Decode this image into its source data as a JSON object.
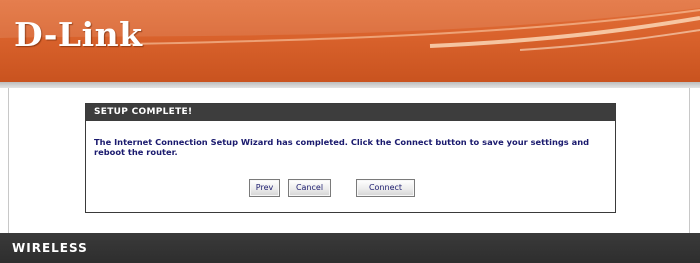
{
  "header": {
    "logo_text": "D-Link",
    "brand_color": "#d9622c"
  },
  "dialog": {
    "title": "SETUP COMPLETE!",
    "message": "The Internet Connection Setup Wizard has completed. Click the Connect button to save your settings and reboot the router.",
    "buttons": {
      "prev_label": "Prev",
      "cancel_label": "Cancel",
      "connect_label": "Connect"
    }
  },
  "footer": {
    "label": "WIRELESS",
    "bar_color": "#333333"
  }
}
